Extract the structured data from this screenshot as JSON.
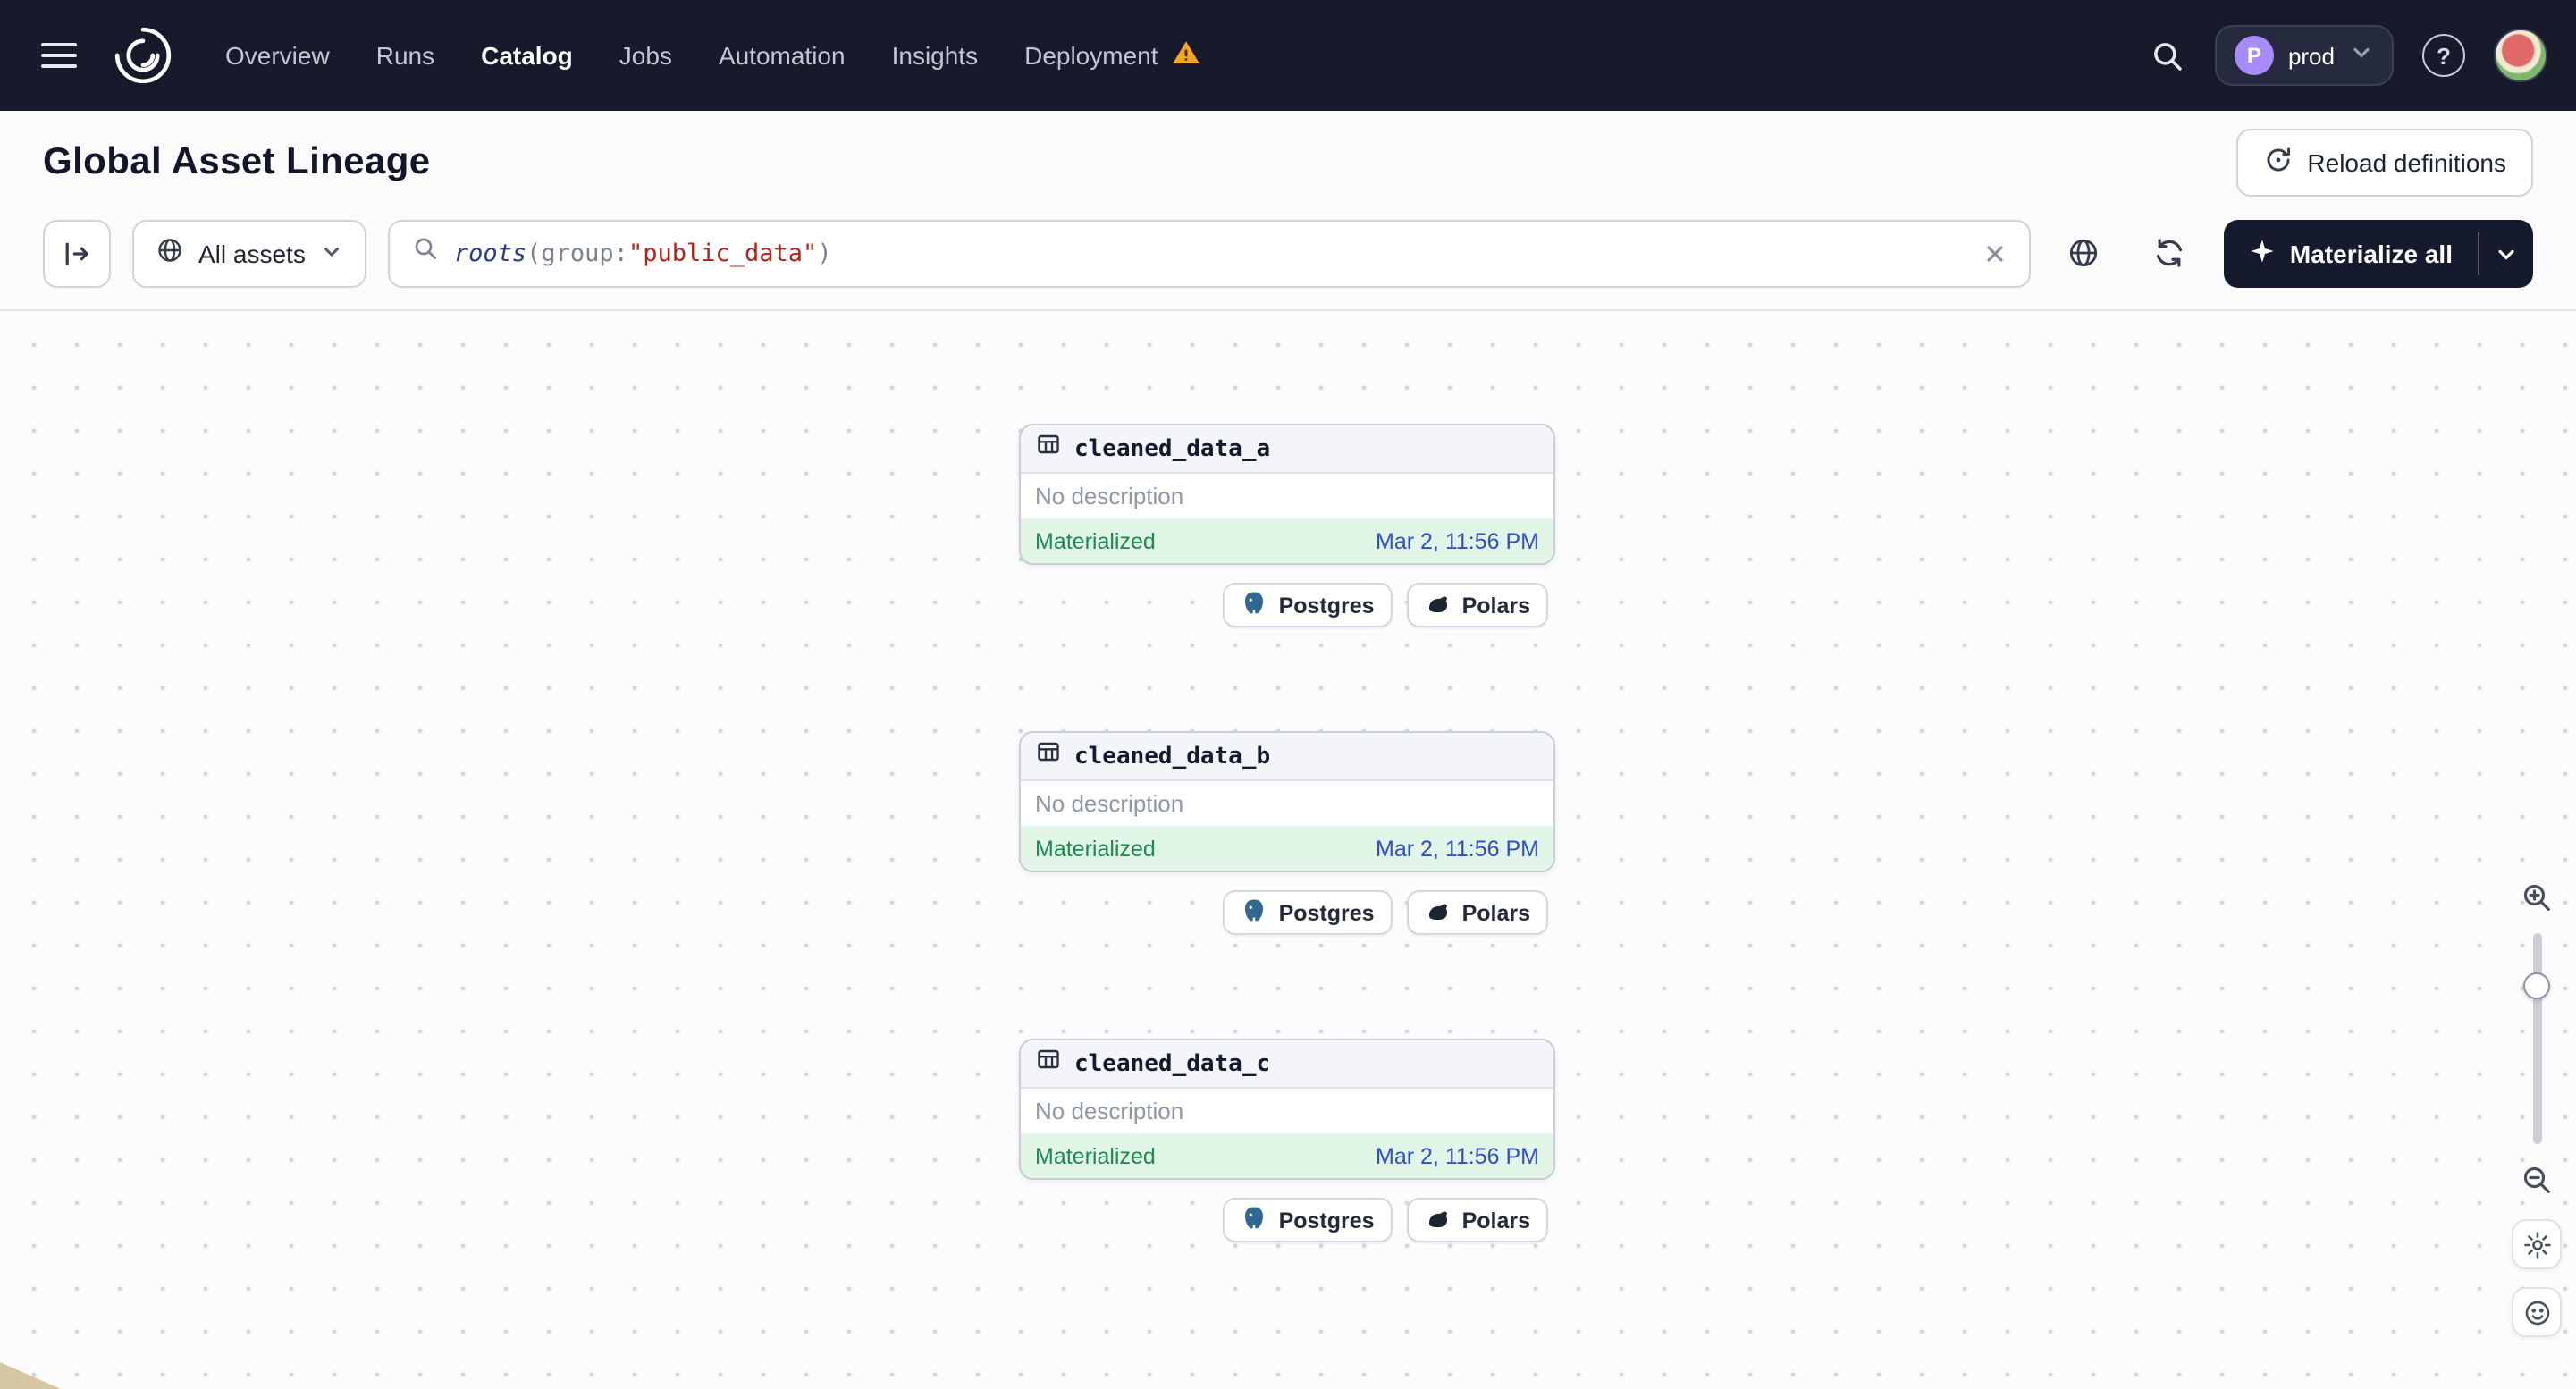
{
  "nav": {
    "items": [
      {
        "label": "Overview"
      },
      {
        "label": "Runs"
      },
      {
        "label": "Catalog"
      },
      {
        "label": "Jobs"
      },
      {
        "label": "Automation"
      },
      {
        "label": "Insights"
      },
      {
        "label": "Deployment"
      }
    ],
    "active_item": "Catalog",
    "deployment_has_warning": true,
    "env_pill": {
      "initial": "P",
      "name": "prod"
    }
  },
  "header": {
    "title": "Global Asset Lineage",
    "reload_label": "Reload definitions"
  },
  "toolbar": {
    "filter_label": "All assets",
    "query": {
      "fn": "roots",
      "open": "(",
      "key": "group:",
      "str": "\"public_data\"",
      "close": ")"
    },
    "materialize_label": "Materialize all"
  },
  "assets": [
    {
      "name": "cleaned_data_a",
      "description": "No description",
      "status": "Materialized",
      "timestamp": "Mar 2, 11:56 PM",
      "tags": [
        {
          "label": "Postgres"
        },
        {
          "label": "Polars"
        }
      ]
    },
    {
      "name": "cleaned_data_b",
      "description": "No description",
      "status": "Materialized",
      "timestamp": "Mar 2, 11:56 PM",
      "tags": [
        {
          "label": "Postgres"
        },
        {
          "label": "Polars"
        }
      ]
    },
    {
      "name": "cleaned_data_c",
      "description": "No description",
      "status": "Materialized",
      "timestamp": "Mar 2, 11:56 PM",
      "tags": [
        {
          "label": "Postgres"
        },
        {
          "label": "Polars"
        }
      ]
    }
  ],
  "icons": {
    "postgres": "postgres-elephant",
    "polars": "polar-bear",
    "warning": "warning-triangle",
    "materialize": "sparkle"
  },
  "colors": {
    "nav_bg": "#161a2b",
    "materialized_bg": "#e2f6e7",
    "materialized_text": "#1a8a4d",
    "link_blue": "#2e4ecb",
    "warning_orange": "#f5a623",
    "query_string_red": "#b42318"
  }
}
